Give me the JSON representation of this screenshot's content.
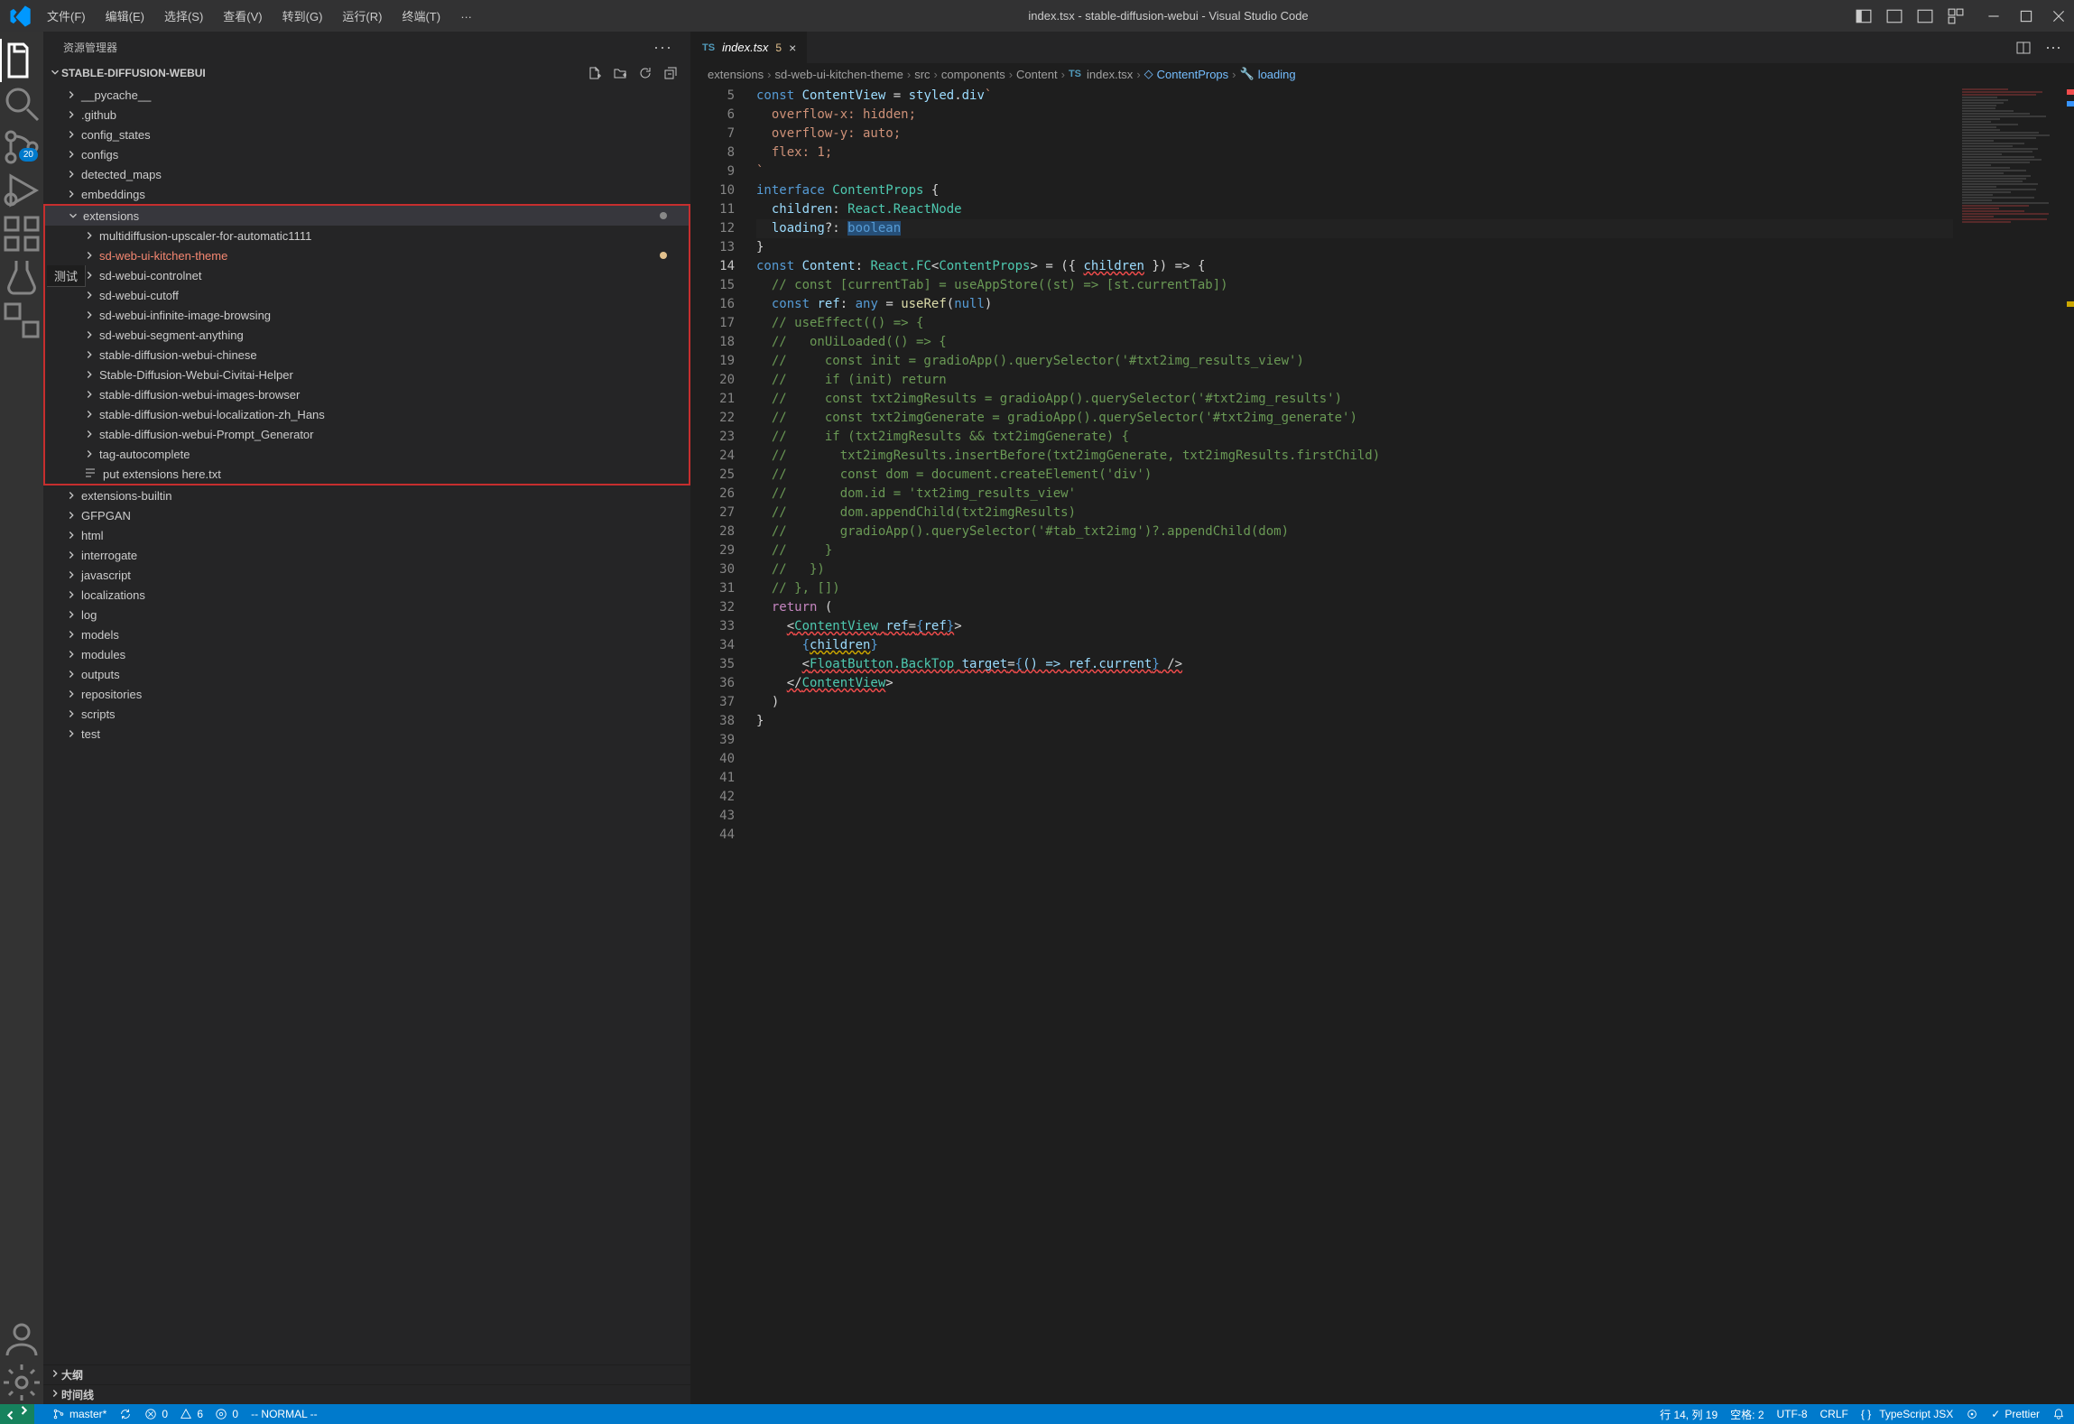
{
  "titlebar": {
    "menus": [
      "文件(F)",
      "编辑(E)",
      "选择(S)",
      "查看(V)",
      "转到(G)",
      "运行(R)",
      "终端(T)"
    ],
    "title": "index.tsx - stable-diffusion-webui - Visual Studio Code"
  },
  "activitybar": {
    "scm_badge": "20"
  },
  "sidebar": {
    "header": "资源管理器",
    "root": "STABLE-DIFFUSION-WEBUI",
    "folders_top": [
      "__pycache__",
      ".github",
      "config_states",
      "configs",
      "detected_maps",
      "embeddings"
    ],
    "extensions_label": "extensions",
    "extensions_children": [
      "multidiffusion-upscaler-for-automatic1111",
      "sd-web-ui-kitchen-theme",
      "sd-webui-controlnet",
      "sd-webui-cutoff",
      "sd-webui-infinite-image-browsing",
      "sd-webui-segment-anything",
      "stable-diffusion-webui-chinese",
      "Stable-Diffusion-Webui-Civitai-Helper",
      "stable-diffusion-webui-images-browser",
      "stable-diffusion-webui-localization-zh_Hans",
      "stable-diffusion-webui-Prompt_Generator",
      "tag-autocomplete"
    ],
    "extensions_file": "put extensions here.txt",
    "folders_bottom": [
      "extensions-builtin",
      "GFPGAN",
      "html",
      "interrogate",
      "javascript",
      "localizations",
      "log",
      "models",
      "modules",
      "outputs",
      "repositories",
      "scripts",
      "test"
    ],
    "outline": "大纲",
    "timeline": "时间线",
    "test_label": "测试"
  },
  "tab": {
    "file": "index.tsx",
    "errnum": "5"
  },
  "breadcrumbs": [
    "extensions",
    "sd-web-ui-kitchen-theme",
    "src",
    "components",
    "Content",
    "index.tsx",
    "ContentProps",
    "loading"
  ],
  "code": {
    "lines": [
      5,
      6,
      7,
      8,
      9,
      10,
      11,
      12,
      13,
      14,
      15,
      16,
      17,
      18,
      19,
      20,
      21,
      22,
      23,
      24,
      25,
      26,
      27,
      28,
      29,
      30,
      31,
      32,
      33,
      34,
      35,
      36,
      37,
      38,
      39,
      40,
      41,
      42,
      43,
      44
    ],
    "current_line": 14,
    "l6_const": "const",
    "l6_name": "ContentView",
    "l6_eq": " = ",
    "l6_styled": "styled",
    "l6_dot": ".",
    "l6_div": "div",
    "l6_tick": "`",
    "l7": "  overflow-x: hidden;",
    "l8": "  overflow-y: auto;",
    "l9": "  flex: 1;",
    "l10": "`",
    "l12_kw": "interface",
    "l12_name": "ContentProps",
    "l12_brace": " {",
    "l13_prop": "  children",
    "l13_colon": ": ",
    "l13_type": "React.ReactNode",
    "l14_prop": "  loading",
    "l14_opt": "?",
    "l14_colon": ": ",
    "l14_type": "boolean",
    "l15": "}",
    "l17_const": "const",
    "l17_name": " Content",
    "l17_colon": ": ",
    "l17_reactfc": "React.FC",
    "l17_lt": "<",
    "l17_cp": "ContentProps",
    "l17_gt": ">",
    "l17_eq": " = (",
    "l17_brace": "{ ",
    "l17_children": "children",
    "l17_brace2": " }",
    "l17_arrow": ") => {",
    "l18": "  // const [currentTab] = useAppStore((st) => [st.currentTab])",
    "l19_const": "  const",
    "l19_ref": " ref",
    "l19_colon": ": ",
    "l19_any": "any",
    "l19_eq": " = ",
    "l19_useref": "useRef",
    "l19_paren": "(",
    "l19_null": "null",
    "l19_paren2": ")",
    "l21": "  // useEffect(() => {",
    "l22": "  //   onUiLoaded(() => {",
    "l23": "  //     const init = gradioApp().querySelector('#txt2img_results_view')",
    "l24": "  //     if (init) return",
    "l25": "  //     const txt2imgResults = gradioApp().querySelector('#txt2img_results')",
    "l26": "  //     const txt2imgGenerate = gradioApp().querySelector('#txt2img_generate')",
    "l27": "  //     if (txt2imgResults && txt2imgGenerate) {",
    "l28": "  //       txt2imgResults.insertBefore(txt2imgGenerate, txt2imgResults.firstChild)",
    "l29": "  //       const dom = document.createElement('div')",
    "l30": "  //       dom.id = 'txt2img_results_view'",
    "l31": "  //       dom.appendChild(txt2imgResults)",
    "l32": "  //       gradioApp().querySelector('#tab_txt2img')?.appendChild(dom)",
    "l33": "  //     }",
    "l34": "  //   })",
    "l35": "  // }, [])",
    "l37_ret": "  return",
    "l37_paren": " (",
    "l38_pad": "    ",
    "l38_open": "<",
    "l38_cv": "ContentView",
    "l38_sp": " ",
    "l38_ref": "ref",
    "l38_eq": "=",
    "l38_br": "{",
    "l38_refv": "ref",
    "l38_br2": "}",
    "l38_close": ">",
    "l39_pad": "      ",
    "l39_br": "{",
    "l39_children": "children",
    "l39_br2": "}",
    "l40_pad": "      ",
    "l40_open": "<",
    "l40_fb": "FloatButton.BackTop",
    "l40_sp": " ",
    "l40_target": "target",
    "l40_eq": "=",
    "l40_br": "{",
    "l40_arrow": "() => ",
    "l40_ref": "ref.current",
    "l40_br2": "}",
    "l40_sp2": " ",
    "l40_close": "/>",
    "l41_pad": "    ",
    "l41_open": "</",
    "l41_cv": "ContentView",
    "l41_close": ">",
    "l42": "  )",
    "l43": "}"
  },
  "status": {
    "branch": "master*",
    "sync": "",
    "errors": "0",
    "warnings": "6",
    "radio": "0",
    "mode": "-- NORMAL --",
    "ln_col": "行 14, 列 19",
    "spaces": "空格: 2",
    "encoding": "UTF-8",
    "eol": "CRLF",
    "lang": "TypeScript JSX",
    "prettier": "Prettier",
    "bell": ""
  }
}
